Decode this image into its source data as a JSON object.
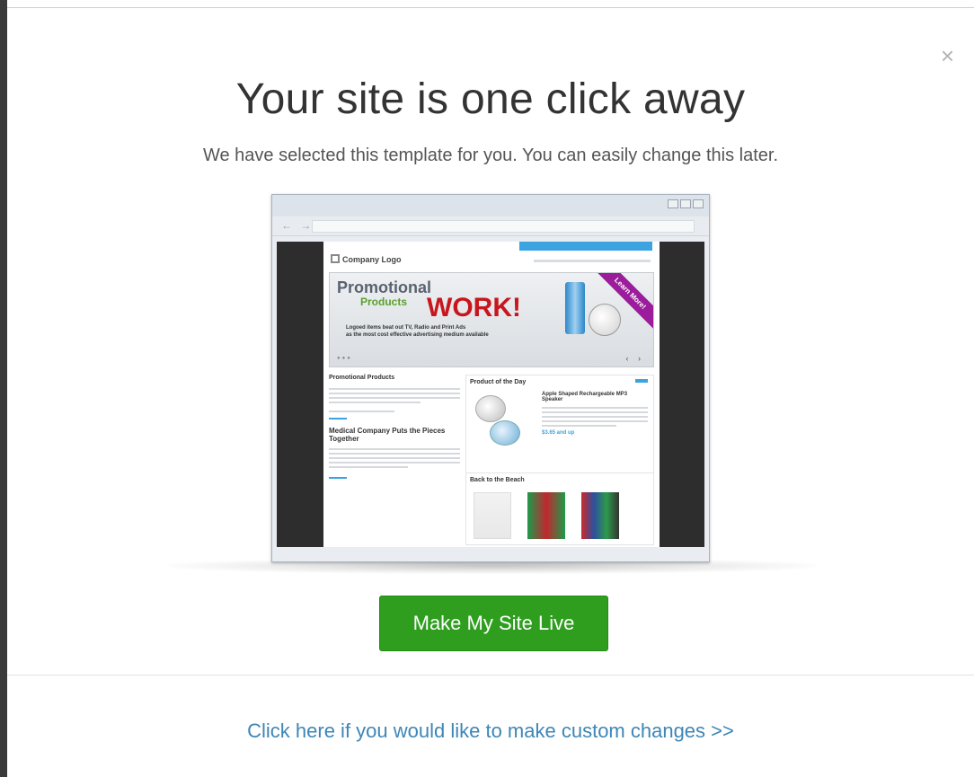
{
  "modal": {
    "close_symbol": "×",
    "title": "Your site is one click away",
    "subtitle": "We have selected this template for you. You can easily change this later."
  },
  "preview": {
    "logo_text": "Company Logo",
    "banner": {
      "line1": "Promotional",
      "line2": "Products",
      "headline": "WORK!",
      "tagline1": "Logoed items beat out TV, Radio and Print Ads",
      "tagline2": "as the most cost effective advertising medium available",
      "ribbon": "Learn More!"
    },
    "left_heading1": "Promotional Products",
    "left_heading2": "Medical Company Puts the Pieces Together",
    "right_heading": "Product of the Day",
    "product_name": "Apple Shaped Rechargeable MP3 Speaker",
    "price_text": "$3.65 and up",
    "section2_heading": "Back to the Beach"
  },
  "actions": {
    "primary_button": "Make My Site Live",
    "custom_link": "Click here if you would like to make custom changes >>"
  }
}
